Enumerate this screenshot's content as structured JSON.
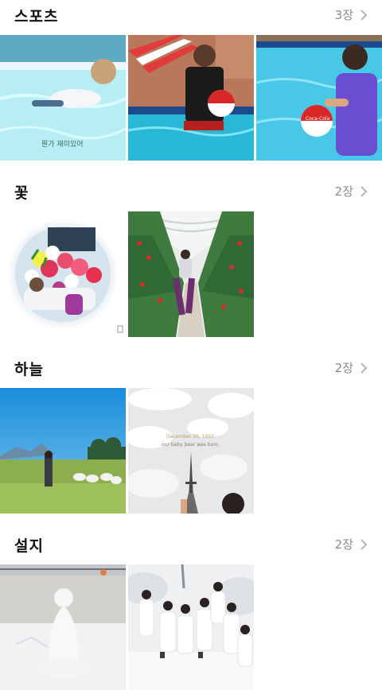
{
  "albums": [
    {
      "title": "스포츠",
      "count": "3장",
      "thumbs": [
        "pool-swimming-photo",
        "pool-beach-ball-photo",
        "pool-coca-cola-ball-photo"
      ]
    },
    {
      "title": "꽃",
      "count": "2장",
      "thumbs": [
        "flower-bouquet-circle-photo",
        "strawberry-greenhouse-photo"
      ]
    },
    {
      "title": "하늘",
      "count": "2장",
      "thumbs": [
        "blue-sky-field-photo",
        "cloudy-sky-tower-photo"
      ]
    },
    {
      "title": "설지",
      "count": "2장",
      "thumbs": [
        "snowman-photo",
        "group-in-snow-photo"
      ]
    }
  ],
  "overlays": {
    "pool_caption": "뭔가 재미있어",
    "cola_text": "Coca-Cola",
    "sky_caption_line1": "December 30, 1992",
    "sky_caption_line2": "our baby bear was born"
  },
  "colors": {
    "title": "#111111",
    "count": "#8a8a8a",
    "chevron": "#b5b5b5",
    "background": "#ffffff"
  },
  "icons": {
    "chevron": "chevron-right-icon"
  }
}
